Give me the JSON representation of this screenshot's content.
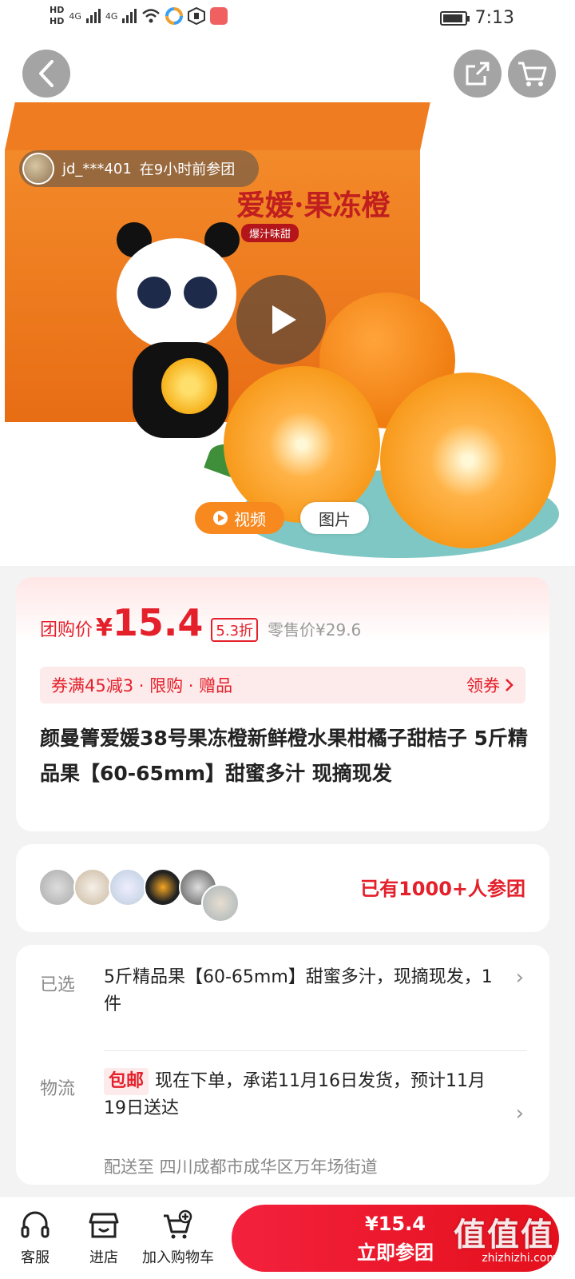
{
  "status_bar": {
    "hd1": "HD",
    "hd2": "HD",
    "net1": "4G",
    "net2": "4G",
    "time": "7:13"
  },
  "hero": {
    "toast_user": "jd_***401",
    "toast_text": "在9小时前参团",
    "box_title": "爱媛·果冻橙",
    "box_sub": "爆汁味甜",
    "tab_video": "视频",
    "tab_image": "图片"
  },
  "price": {
    "label": "团购价",
    "yen": "¥",
    "value": "15.4",
    "discount": "5.3折",
    "retail": "零售价¥29.6",
    "promo_text": "券满45减3 · 限购 · 赠品",
    "promo_action": "领券",
    "title": "颜曼箐爱媛38号果冻橙新鲜橙水果柑橘子甜桔子 5斤精品果【60-65mm】甜蜜多汁 现摘现发"
  },
  "group": {
    "text": "已有1000+人参团"
  },
  "details": {
    "selected_label": "已选",
    "selected_value": "5斤精品果【60-65mm】甜蜜多汁，现摘现发，1件",
    "logistics_label": "物流",
    "free_shipping": "包邮",
    "logistics_value": "现在下单，承诺11月16日发货，预计11月19日送达",
    "ship_to": "配送至  四川成都市成华区万年场街道"
  },
  "bottom": {
    "service": "客服",
    "store": "进店",
    "add_cart": "加入购物车",
    "cta_price": "¥15.4",
    "cta_label": "立即参团",
    "watermark": "值值值",
    "watermark_url": "zhizhizhi.com"
  },
  "colors": {
    "accent_red": "#e4202b",
    "orange": "#f7891f"
  }
}
